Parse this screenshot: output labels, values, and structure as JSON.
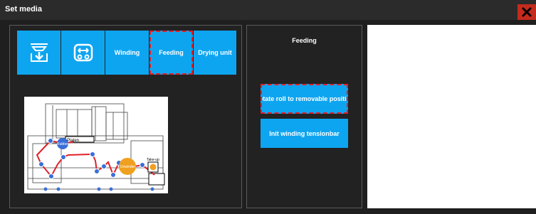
{
  "window": {
    "title": "Set media",
    "close_label": "X"
  },
  "tabs": [
    {
      "id": "media-load",
      "label": "",
      "icon": "media-load-icon"
    },
    {
      "id": "printhead",
      "label": "",
      "icon": "transport-icon"
    },
    {
      "id": "winding",
      "label": "Winding"
    },
    {
      "id": "feeding",
      "label": "Feeding",
      "selected": true
    },
    {
      "id": "drying",
      "label": "Drying unit"
    }
  ],
  "diagram": {
    "labels": {
      "platen": "Platen",
      "rubber": "Rubber",
      "unwinder": "Unwinder",
      "takeup": "Take-up"
    }
  },
  "feeding_panel": {
    "title": "Feeding",
    "buttons": [
      {
        "label": "Rotate roll to removable position",
        "highlighted": true
      },
      {
        "label": "Init winding tensionbar"
      }
    ]
  },
  "colors": {
    "accent": "#0ea5f0",
    "highlight": "#e0202a",
    "close": "#c42b1c",
    "unwinder": "#f0a020"
  }
}
